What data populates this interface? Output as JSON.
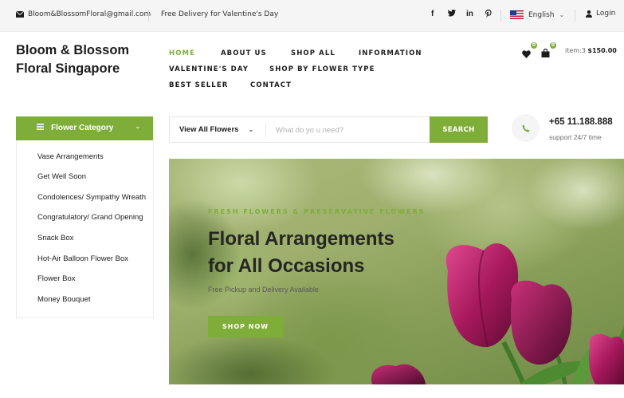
{
  "topbar": {
    "email": "Bloom&BlossomFloral@gmail.com",
    "delivery": "Free Delivery for Valentine's Day",
    "social": [
      "f",
      "y",
      "in",
      "p"
    ],
    "language": "English",
    "login": "Login"
  },
  "header": {
    "logo_line1": "Bloom & Blossom",
    "logo_line2": "Floral Singapore",
    "nav": [
      {
        "label": "HOME",
        "active": true
      },
      {
        "label": "ABOUT US"
      },
      {
        "label": "SHOP ALL"
      },
      {
        "label": "INFORMATION"
      },
      {
        "label": "VALENTINE'S DAY"
      },
      {
        "label": "SHOP BY FLOWER TYPE"
      },
      {
        "label": "BEST SELLER"
      },
      {
        "label": "CONTACT"
      }
    ],
    "wishlist_count": "0",
    "cart_count": "0",
    "cart_items_label": "item:3",
    "cart_total": "$150.00"
  },
  "category": {
    "title": "Flower Category",
    "items": [
      "Vase Arrangements",
      "Get Well Soon",
      "Condolences/ Sympathy Wreath",
      "Congratulatory/ Grand Opening",
      "Snack Box",
      "Hot-Air Balloon Flower Box",
      "Flower Box",
      "Money Bouquet"
    ]
  },
  "search": {
    "category": "View All Flowers",
    "placeholder": "What do yo u need?",
    "button": "SEARCH"
  },
  "contact": {
    "phone": "+65 11.188.888",
    "support": "support 24/7 time"
  },
  "hero": {
    "kicker": "FRESH FLOWERS & PRESERVATIVE FLOWERS",
    "title_line1": "Floral Arrangements",
    "title_line2": "for All Occasions",
    "subtitle": "Free Pickup and Delivery Available",
    "button": "SHOP NOW"
  },
  "colors": {
    "accent": "#7fad39",
    "text": "#1c1c1c",
    "topbar_bg": "#f5f5f5"
  },
  "icons": {
    "email": "envelope-icon",
    "login": "user-icon",
    "wishlist": "heart-icon",
    "cart": "shopping-bag-icon",
    "phone": "phone-icon",
    "category_menu": "hamburger-icon"
  }
}
